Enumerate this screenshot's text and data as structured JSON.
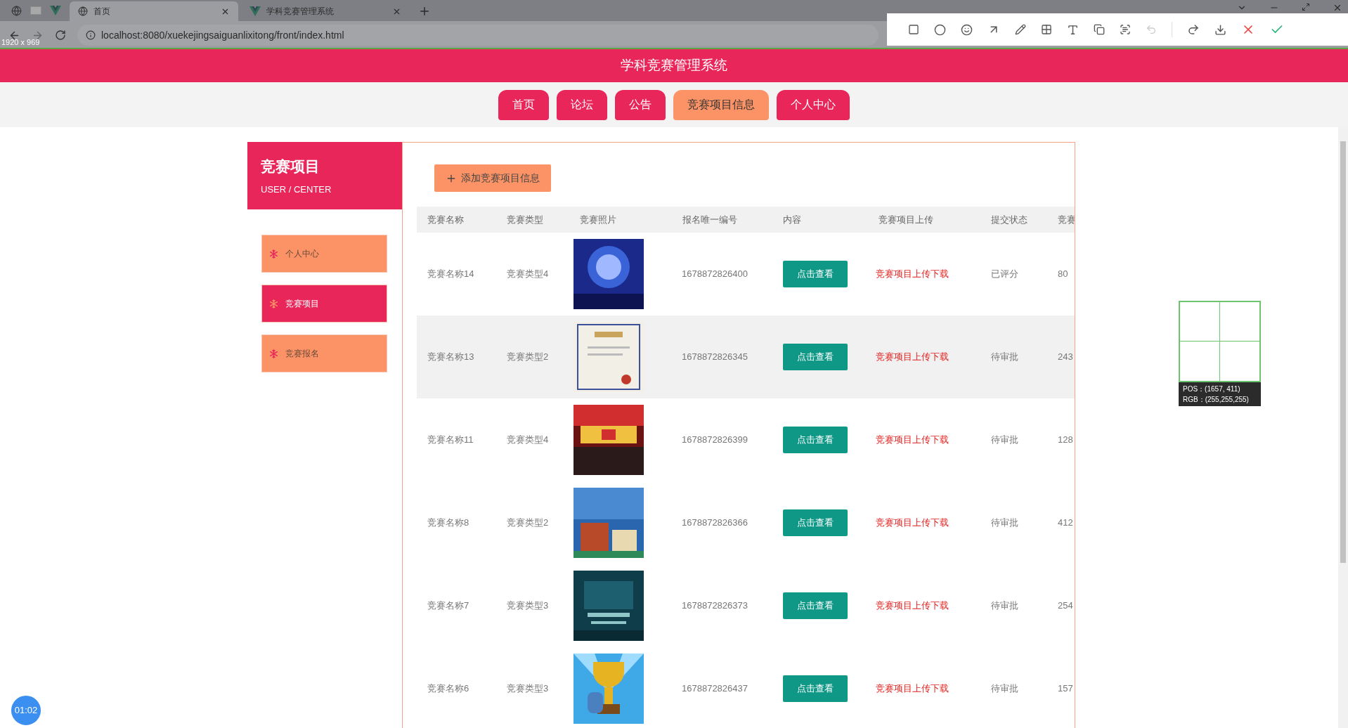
{
  "browser": {
    "tabs": [
      {
        "title": "首页",
        "kind": "globe",
        "selected": true
      },
      {
        "title": "学科竞赛管理系统",
        "kind": "vue",
        "selected": false
      }
    ],
    "address": "localhost:8080/xuekejingsaiguanlixitong/front/index.html",
    "size_label": "1920 x 969"
  },
  "header": {
    "title": "学科竞赛管理系统"
  },
  "nav": [
    {
      "label": "首页",
      "selected": false
    },
    {
      "label": "论坛",
      "selected": false
    },
    {
      "label": "公告",
      "selected": false
    },
    {
      "label": "竞赛项目信息",
      "selected": true
    },
    {
      "label": "个人中心",
      "selected": false
    }
  ],
  "sidebar": {
    "title": "竞赛项目",
    "subtitle": "USER / CENTER",
    "items": [
      {
        "label": "个人中心",
        "selected": false
      },
      {
        "label": "竞赛项目",
        "selected": true
      },
      {
        "label": "竞赛报名",
        "selected": false
      }
    ]
  },
  "add_button": "添加竞赛项目信息",
  "table": {
    "columns": [
      "竞赛名称",
      "竞赛类型",
      "竞赛照片",
      "报名唯一编号",
      "内容",
      "竞赛项目上传",
      "提交状态",
      "竞赛"
    ],
    "rows": [
      {
        "name": "竞赛名称14",
        "type": "竞赛类型4",
        "number": "1678872826400",
        "action": "点击查看",
        "upload": "竞赛项目上传下载",
        "status": "已评分",
        "column_8": "80",
        "highlighted": false
      },
      {
        "name": "竞赛名称13",
        "type": "竞赛类型2",
        "number": "1678872826345",
        "action": "点击查看",
        "upload": "竞赛项目上传下载",
        "status": "待审批",
        "column_8": "243",
        "highlighted": true
      },
      {
        "name": "竞赛名称11",
        "type": "竞赛类型4",
        "number": "1678872826399",
        "action": "点击查看",
        "upload": "竞赛项目上传下载",
        "status": "待审批",
        "column_8": "128",
        "highlighted": false
      },
      {
        "name": "竞赛名称8",
        "type": "竞赛类型2",
        "number": "1678872826366",
        "action": "点击查看",
        "upload": "竞赛项目上传下载",
        "status": "待审批",
        "column_8": "412",
        "highlighted": false
      },
      {
        "name": "竞赛名称7",
        "type": "竞赛类型3",
        "number": "1678872826373",
        "action": "点击查看",
        "upload": "竞赛项目上传下载",
        "status": "待审批",
        "column_8": "254",
        "highlighted": false
      },
      {
        "name": "竞赛名称6",
        "type": "竞赛类型3",
        "number": "1678872826437",
        "action": "点击查看",
        "upload": "竞赛项目上传下载",
        "status": "待审批",
        "column_8": "157",
        "highlighted": false
      }
    ]
  },
  "picker": {
    "pos": "POS：(1657, 411)",
    "rgb": "RGB：(255,255,255)"
  },
  "timer": "01:02"
}
